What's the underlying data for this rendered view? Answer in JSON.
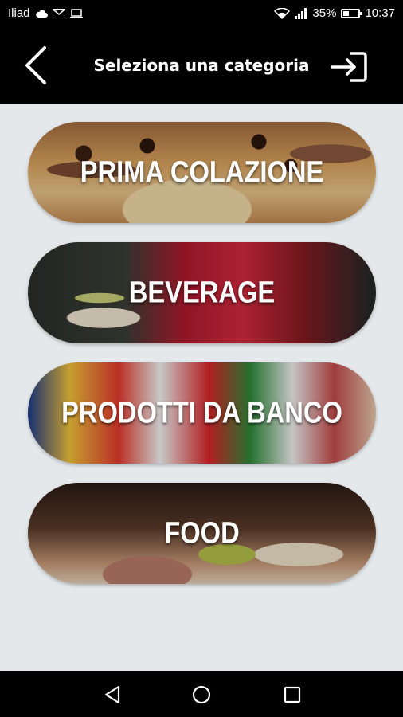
{
  "status_bar": {
    "carrier": "Iliad",
    "icons_left": [
      "cloud-icon",
      "gmail-icon",
      "laptop-icon"
    ],
    "icons_right": [
      "wifi-icon",
      "signal-icon"
    ],
    "battery": "35%",
    "battery_level": 0.35,
    "time": "10:37"
  },
  "app_bar": {
    "title": "Seleziona una categoria",
    "back_icon": "chevron-left-icon",
    "login_icon": "login-icon"
  },
  "categories": [
    {
      "label": "PRIMA COLAZIONE"
    },
    {
      "label": "BEVERAGE"
    },
    {
      "label": "PRODOTTI DA BANCO"
    },
    {
      "label": "FOOD"
    }
  ],
  "nav_bar": {
    "buttons": [
      "back-triangle-icon",
      "home-circle-icon",
      "recents-square-icon"
    ]
  },
  "colors": {
    "app_bar_bg": "#000000",
    "content_bg": "#e4e8ea",
    "label_text": "#ffffff"
  }
}
